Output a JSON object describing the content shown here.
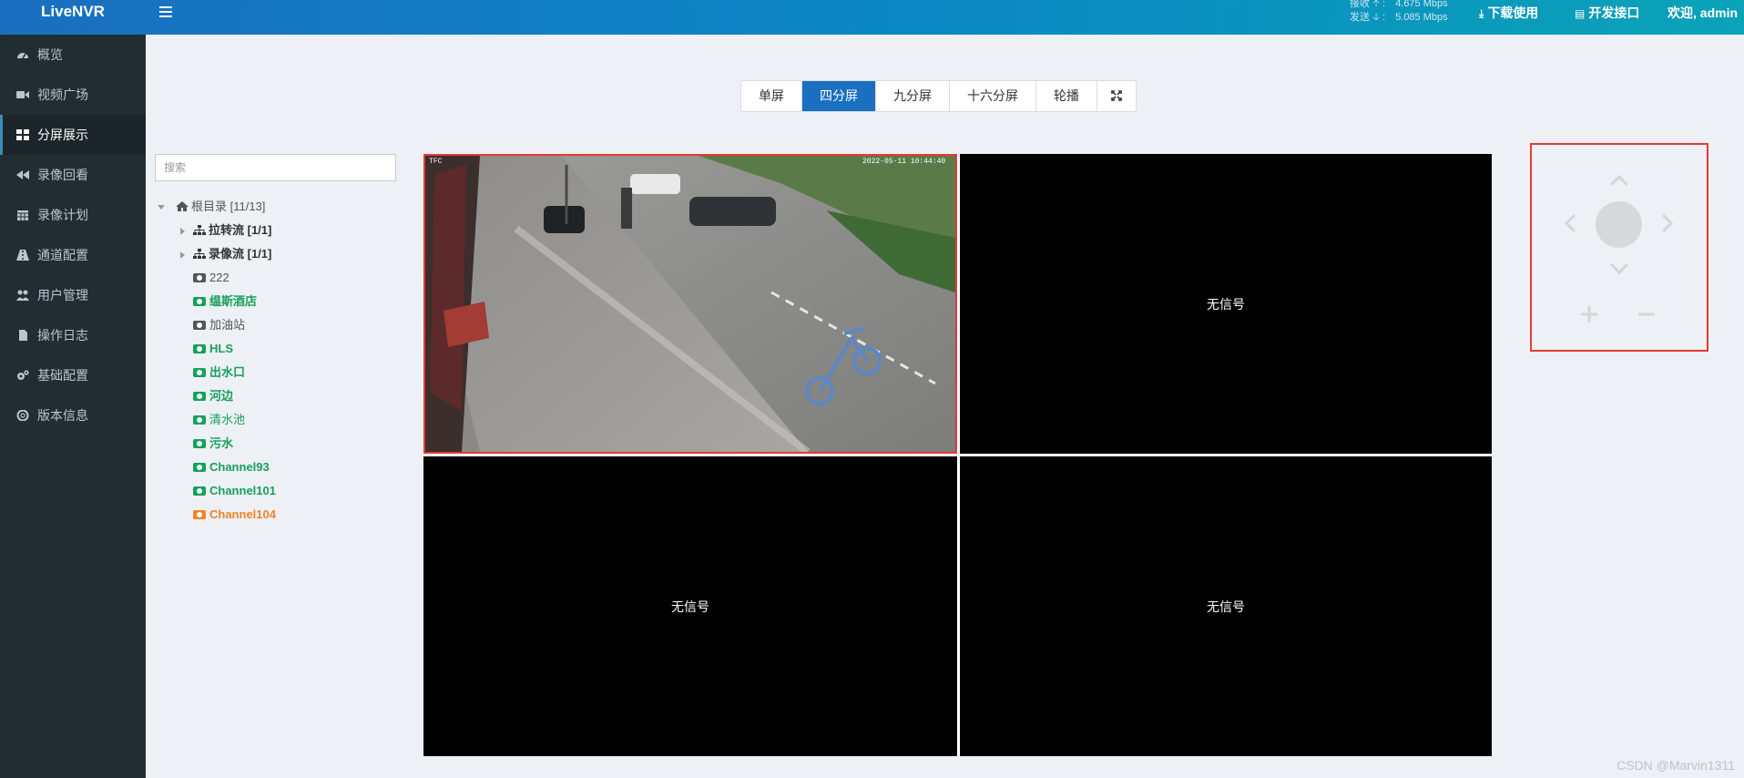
{
  "header": {
    "logo": "LiveNVR",
    "net": {
      "recv_label": "接收",
      "recv_value": "4.675 Mbps",
      "send_label": "发送",
      "send_value": "5.085 Mbps"
    },
    "download_label": "下载使用",
    "api_label": "开发接口",
    "welcome_label": "欢迎, admin"
  },
  "sidebar": {
    "items": [
      {
        "label": "概览",
        "icon": "dashboard-icon"
      },
      {
        "label": "视频广场",
        "icon": "video-camera-icon"
      },
      {
        "label": "分屏展示",
        "icon": "grid-icon",
        "active": true
      },
      {
        "label": "录像回看",
        "icon": "backward-icon"
      },
      {
        "label": "录像计划",
        "icon": "calendar-icon"
      },
      {
        "label": "通道配置",
        "icon": "road-icon"
      },
      {
        "label": "用户管理",
        "icon": "users-icon"
      },
      {
        "label": "操作日志",
        "icon": "file-icon"
      },
      {
        "label": "基础配置",
        "icon": "gears-icon"
      },
      {
        "label": "版本信息",
        "icon": "lifebuoy-icon"
      }
    ]
  },
  "layout_tabs": {
    "items": [
      "单屏",
      "四分屏",
      "九分屏",
      "十六分屏",
      "轮播"
    ],
    "active": "四分屏",
    "fullscreen_icon": "fullscreen-icon"
  },
  "search": {
    "placeholder": "搜索"
  },
  "tree": {
    "root": "根目录 [11/13]",
    "groups": [
      "拉转流 [1/1]",
      "录像流 [1/1]"
    ],
    "channels": [
      {
        "label": "222",
        "status": "gray"
      },
      {
        "label": "缊斯酒店",
        "status": "green"
      },
      {
        "label": "加油站",
        "status": "gray"
      },
      {
        "label": "HLS",
        "status": "green"
      },
      {
        "label": "出水口",
        "status": "green"
      },
      {
        "label": "河边",
        "status": "green"
      },
      {
        "label": "清水池",
        "status": "green"
      },
      {
        "label": "污水",
        "status": "green"
      },
      {
        "label": "Channel93",
        "status": "green"
      },
      {
        "label": "Channel101",
        "status": "green"
      },
      {
        "label": "Channel104",
        "status": "orange"
      }
    ]
  },
  "grid": {
    "cell1": {
      "osd_left": "TFC",
      "osd_right": "2022-05-11 10:44:40"
    },
    "no_signal": "无信号"
  },
  "colors": {
    "header_start": "#1a6fc0",
    "header_end": "#0aa3b8",
    "sidebar_bg": "#222d32",
    "online_green": "#17a05d",
    "offline_gray": "#555555",
    "alert_orange": "#f0842a",
    "selected_border": "#e53935"
  },
  "watermark": "CSDN @Marvin1311"
}
